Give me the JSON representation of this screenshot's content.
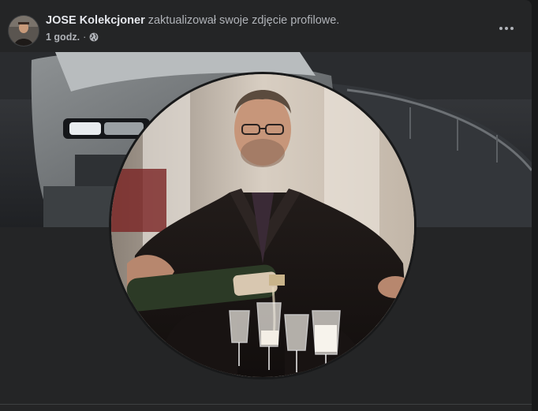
{
  "post": {
    "author_name": "JOSE Kolekcjoner",
    "action_text": " zaktualizował swoje zdjęcie profilowe.",
    "time_label": "1 godz.",
    "separator": " · "
  },
  "icons": {
    "privacy": "globe-icon",
    "menu": "more-options-icon"
  },
  "colors": {
    "card_bg": "#242526",
    "page_bg": "#18191a",
    "primary_text": "#e4e6eb",
    "secondary_text": "#b0b3b8"
  }
}
